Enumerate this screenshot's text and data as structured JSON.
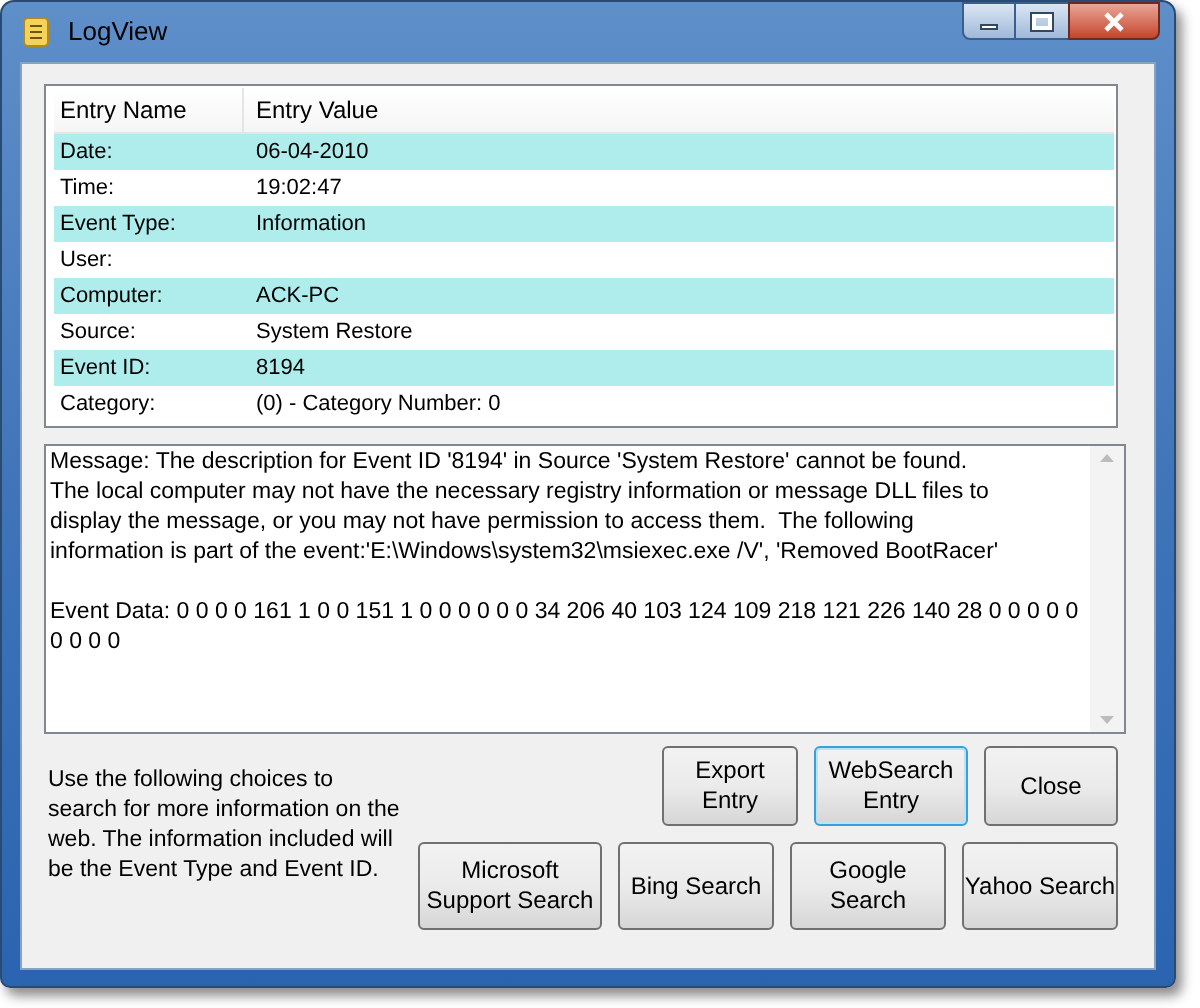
{
  "window": {
    "title": "LogView"
  },
  "table": {
    "columns": [
      "Entry Name",
      "Entry Value"
    ],
    "rows": [
      {
        "name": "Date:",
        "value": "06-04-2010"
      },
      {
        "name": "Time:",
        "value": "19:02:47"
      },
      {
        "name": "Event Type:",
        "value": "Information"
      },
      {
        "name": "User:"
      },
      {
        "name": "Computer:",
        "value": "ACK-PC"
      },
      {
        "name": "Source:",
        "value": "System Restore"
      },
      {
        "name": "Event ID:",
        "value": "8194"
      },
      {
        "name": "Category:",
        "value": "(0) - Category Number: 0"
      }
    ]
  },
  "message_paragraphs": [
    [
      "Message: The description for Event ID '8194' in Source 'System Restore' cannot be found.",
      "The local computer may not have the necessary registry information or message DLL files to",
      "display the message, or you may not have permission to access them.  The following",
      "information is part of the event:'E:\\Windows\\system32\\msiexec.exe /V', 'Removed BootRacer'"
    ],
    [
      "Event Data: 0 0 0 0 161 1 0 0 151 1 0 0 0 0 0 0 34 206 40 103 124 109 218 121 226 140 28 0 0 0 0 0",
      "0 0 0 0"
    ]
  ],
  "hint": "Use the following choices to search for more information on the web. The information included will be the Event Type and Event ID.",
  "top_buttons": [
    {
      "label": "Export Entry",
      "focused": false
    },
    {
      "label": "WebSearch Entry",
      "focused": true
    },
    {
      "label": "Close",
      "focused": false
    }
  ],
  "search_buttons": [
    {
      "label": "Microsoft Support Search",
      "focused": false
    },
    {
      "label": "Bing Search",
      "focused": false
    },
    {
      "label": "Google Search",
      "focused": false
    },
    {
      "label": "Yahoo Search",
      "focused": false
    }
  ]
}
